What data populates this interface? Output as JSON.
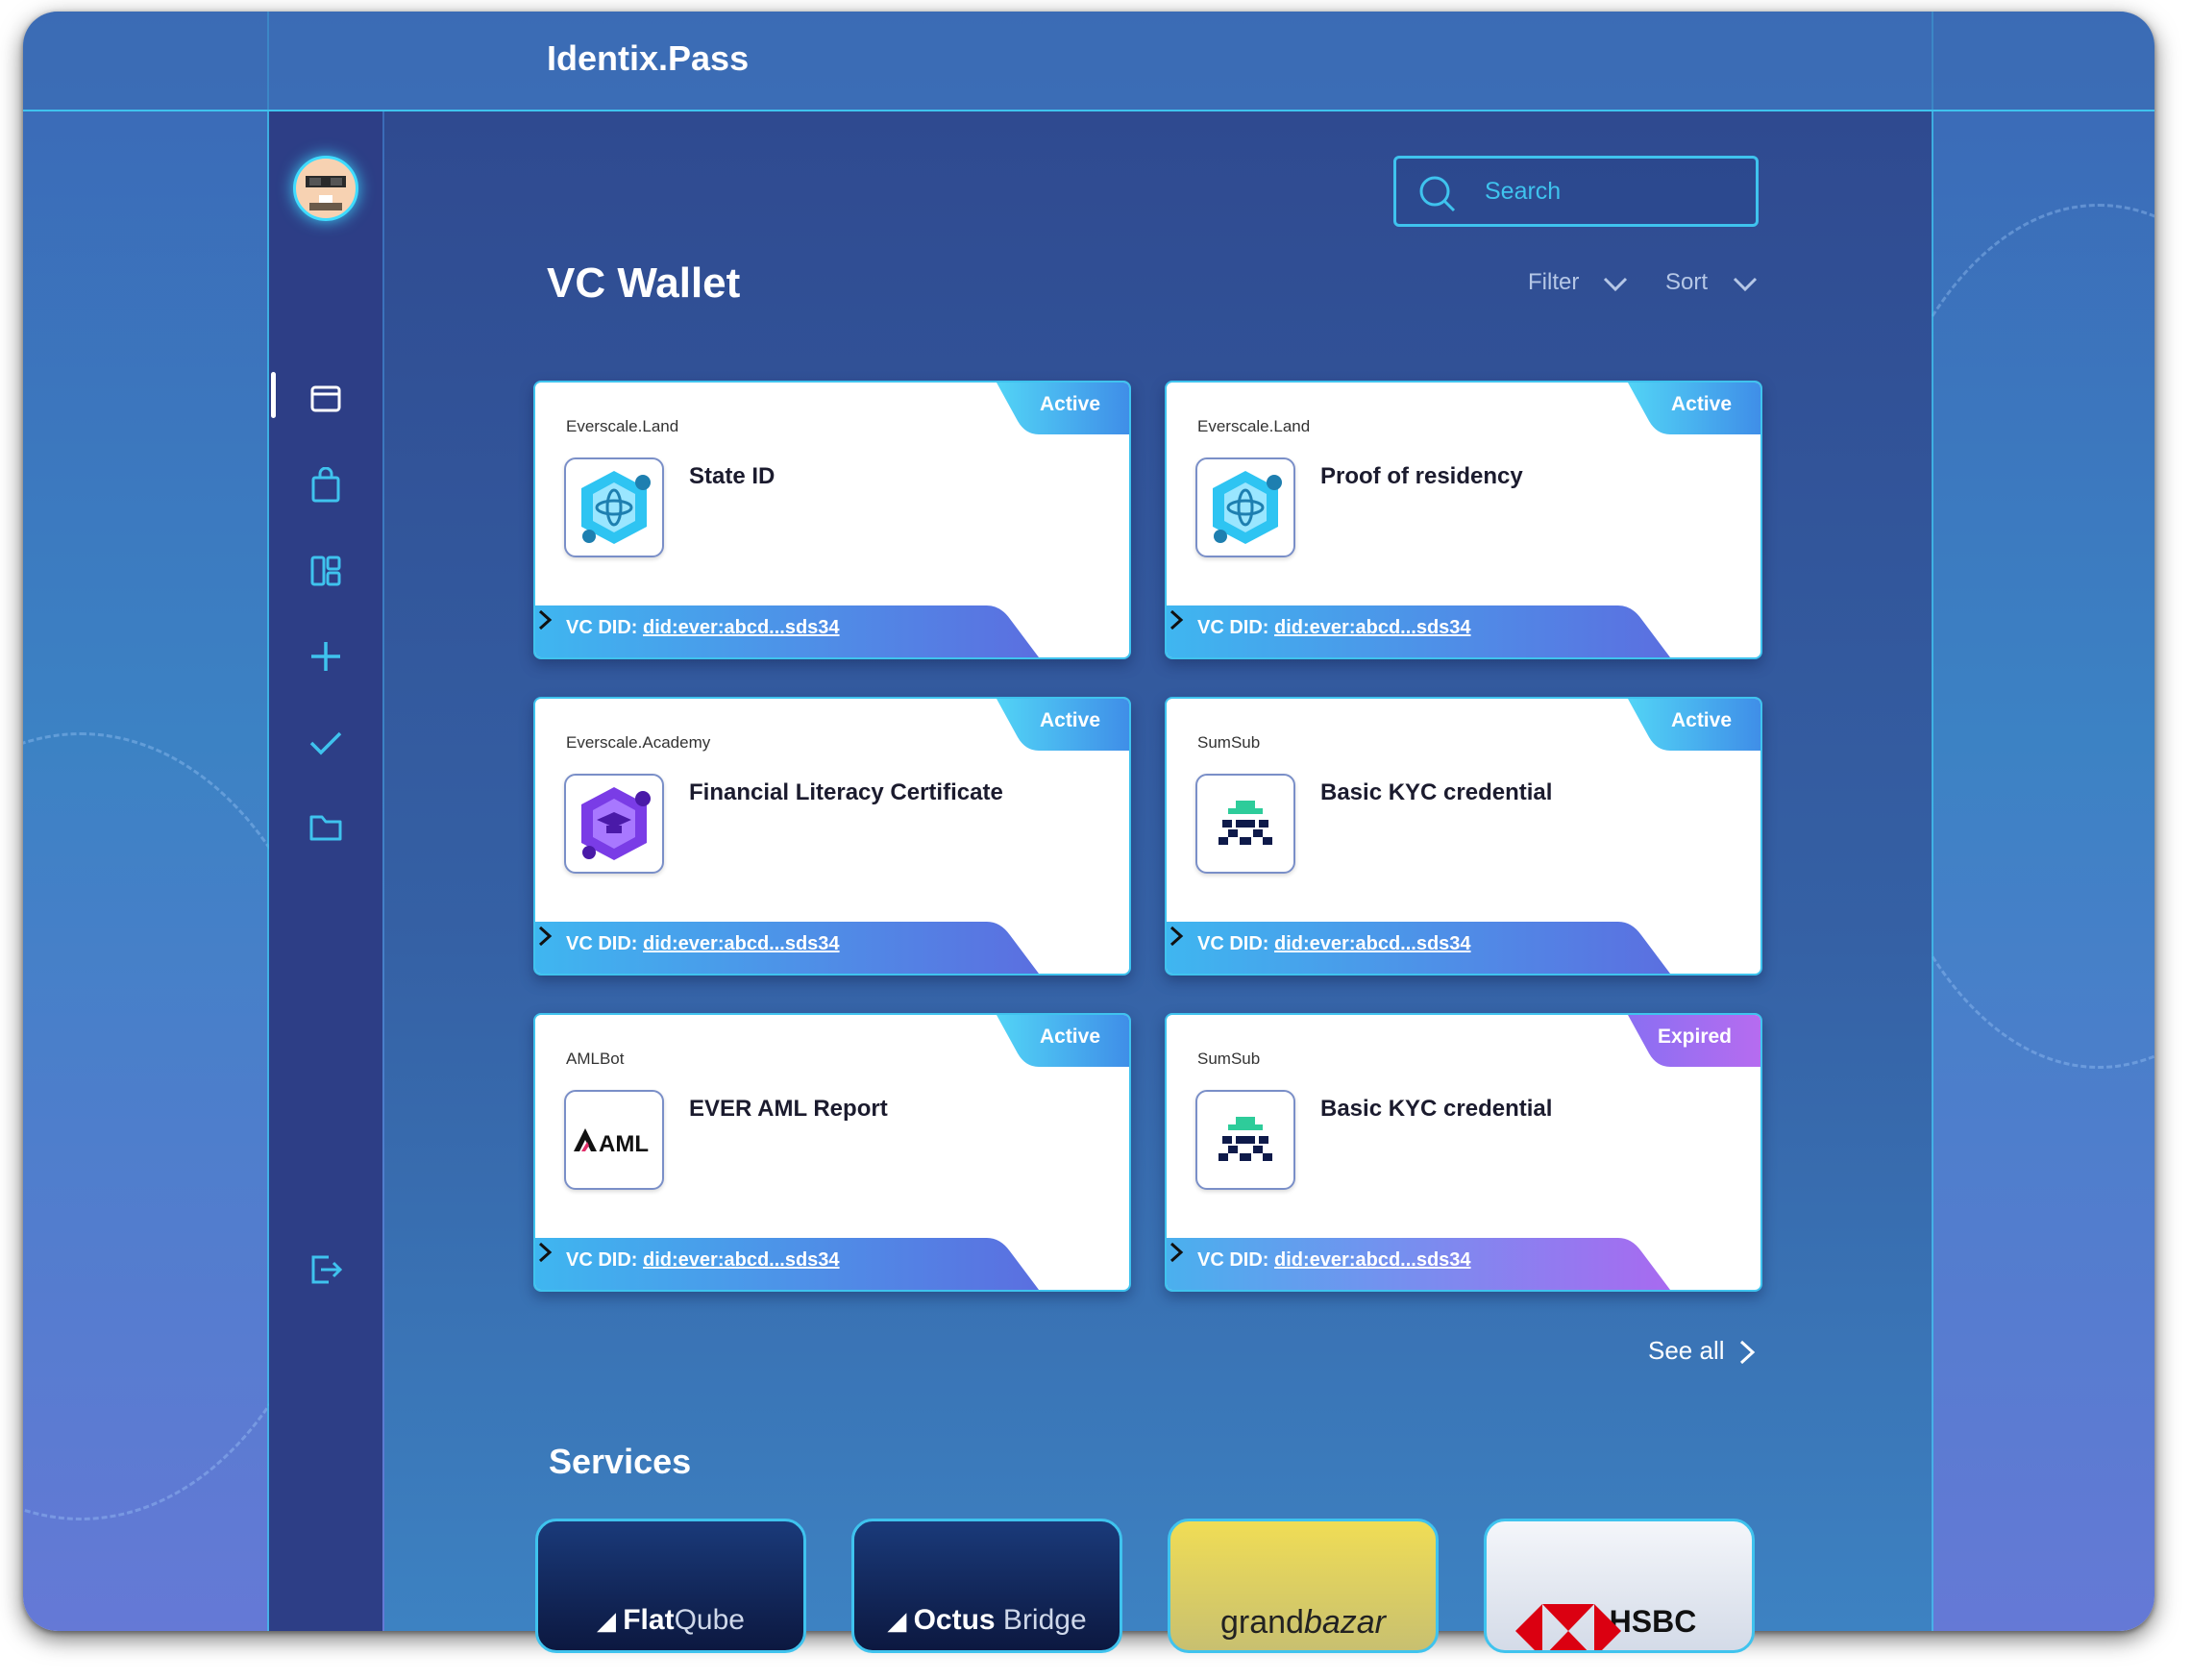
{
  "app": {
    "title": "Identix.Pass"
  },
  "sidebar": {
    "avatar_label": "user-avatar",
    "items": [
      {
        "icon": "wallet-icon"
      },
      {
        "icon": "shopping-bag-icon"
      },
      {
        "icon": "dashboard-icon"
      },
      {
        "icon": "plus-icon"
      },
      {
        "icon": "check-icon"
      },
      {
        "icon": "folder-icon"
      }
    ],
    "logout_icon": "logout-icon"
  },
  "search": {
    "placeholder": "Search"
  },
  "wallet": {
    "title": "VC Wallet",
    "filter_label": "Filter",
    "sort_label": "Sort",
    "see_all_label": "See all",
    "did_prefix": "VC DID:",
    "cards": [
      {
        "issuer": "Everscale.Land",
        "title": "State ID",
        "status": "Active",
        "did": "did:ever:abcd...sds34",
        "logo": "everscale-land-logo"
      },
      {
        "issuer": "Everscale.Land",
        "title": "Proof of residency",
        "status": "Active",
        "did": "did:ever:abcd...sds34",
        "logo": "everscale-land-logo"
      },
      {
        "issuer": "Everscale.Academy",
        "title": "Financial Literacy Certificate",
        "status": "Active",
        "did": "did:ever:abcd...sds34",
        "logo": "everscale-academy-logo"
      },
      {
        "issuer": "SumSub",
        "title": "Basic KYC credential",
        "status": "Active",
        "did": "did:ever:abcd...sds34",
        "logo": "sumsub-logo"
      },
      {
        "issuer": "AMLBot",
        "title": "EVER AML Report",
        "status": "Active",
        "did": "did:ever:abcd...sds34",
        "logo": "aml-logo",
        "logo_text": "AML"
      },
      {
        "issuer": "SumSub",
        "title": "Basic KYC credential",
        "status": "Expired",
        "did": "did:ever:abcd...sds34",
        "logo": "sumsub-logo"
      }
    ]
  },
  "services": {
    "title": "Services",
    "items": [
      {
        "name_bold": "Flat",
        "name_light": "Qube"
      },
      {
        "name_bold": "Octus",
        "name_light": " Bridge"
      },
      {
        "name_bold": "grand",
        "name_light": "bazar"
      },
      {
        "name_bold": "HSBC",
        "name_light": ""
      }
    ]
  },
  "colors": {
    "accent": "#3fc3ee",
    "active_badge": "#3fb6f0",
    "expired_badge": "#a86af0",
    "sidebar_bg": "#2d3e86"
  }
}
